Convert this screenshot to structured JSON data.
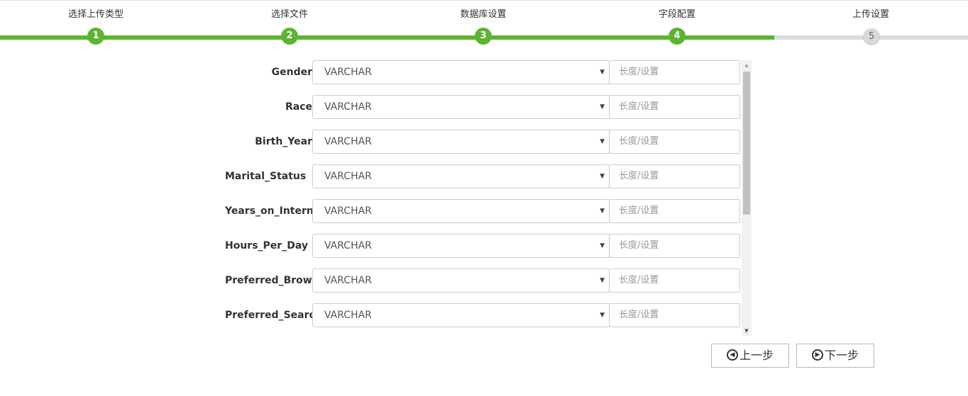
{
  "steps": [
    {
      "label": "选择上传类型",
      "number": "1",
      "status": "done"
    },
    {
      "label": "选择文件",
      "number": "2",
      "status": "done"
    },
    {
      "label": "数据库设置",
      "number": "3",
      "status": "done"
    },
    {
      "label": "字段配置",
      "number": "4",
      "status": "current"
    },
    {
      "label": "上传设置",
      "number": "5",
      "status": "pending"
    }
  ],
  "fields": [
    {
      "name": "Gender",
      "type": "VARCHAR",
      "length_placeholder": "长度/设置"
    },
    {
      "name": "Race",
      "type": "VARCHAR",
      "length_placeholder": "长度/设置"
    },
    {
      "name": "Birth_Year",
      "type": "VARCHAR",
      "length_placeholder": "长度/设置"
    },
    {
      "name": "Marital_Status",
      "type": "VARCHAR",
      "length_placeholder": "长度/设置"
    },
    {
      "name": "Years_on_Internet",
      "type": "VARCHAR",
      "length_placeholder": "长度/设置"
    },
    {
      "name": "Hours_Per_Day",
      "type": "VARCHAR",
      "length_placeholder": "长度/设置"
    },
    {
      "name": "Preferred_Browse",
      "type": "VARCHAR",
      "length_placeholder": "长度/设置"
    },
    {
      "name": "Preferred_Search_",
      "type": "VARCHAR",
      "length_placeholder": "长度/设置"
    }
  ],
  "buttons": {
    "prev_label": "上一步",
    "next_label": "下一步"
  },
  "colors": {
    "accent_green": "#5cb531",
    "pending_gray": "#dcdcdc"
  }
}
